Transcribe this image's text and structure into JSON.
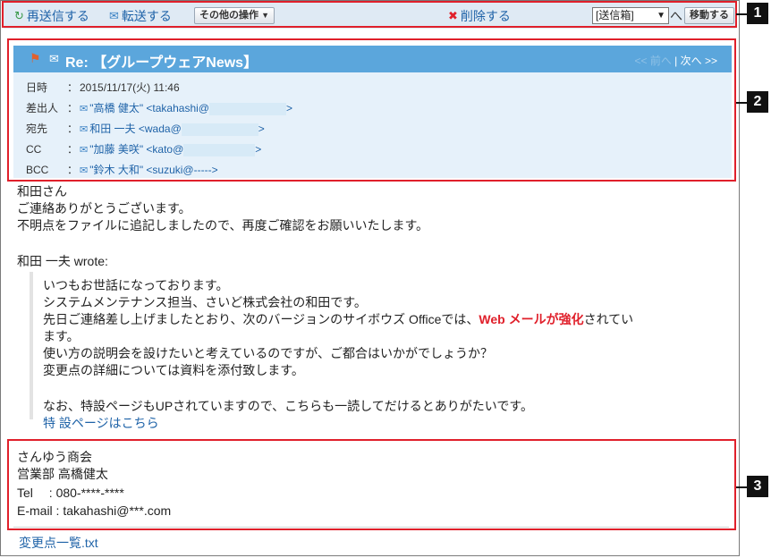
{
  "toolbar": {
    "resend": "再送信する",
    "forward": "転送する",
    "other_ops": "その他の操作",
    "delete": "削除する",
    "folder_value": "[送信箱]",
    "to_suffix": "へ",
    "move": "移動する"
  },
  "header": {
    "subject": "Re: 【グループウェアNews】",
    "prev": "<< 前へ",
    "sep": "|",
    "next": "次へ >>",
    "rows": [
      {
        "label": "日時",
        "colon": "：",
        "value": "2015/11/17(火) 11:46"
      },
      {
        "label": "差出人",
        "colon": "：",
        "value_pre": "\"高橋 健太\" <takahashi@",
        "value_post": ">"
      },
      {
        "label": "宛先",
        "colon": "：",
        "value_pre": "和田 一夫 <wada@",
        "value_post": ">"
      },
      {
        "label": "CC",
        "colon": "：",
        "value_pre": "\"加藤 美咲\" <kato@",
        "value_post": ">"
      },
      {
        "label": "BCC",
        "colon": "：",
        "value_pre": "\"鈴木 大和\" <suzuki@----->",
        "value_post": ""
      }
    ]
  },
  "body": {
    "l1": "和田さん",
    "l2": "ご連絡ありがとうございます。",
    "l3": "不明点をファイルに追記しましたので、再度ご確認をお願いいたします。",
    "l4": "和田 一夫 wrote:",
    "q1": "いつもお世話になっております。",
    "q2": "システムメンテナンス担当、さいど株式会社の和田です。",
    "q3_pre": "先日ご連絡差し上げましたとおり、次のバージョンのサイボウズ Officeでは、",
    "q3_red": "Web メールが強化",
    "q3_post": "されてい",
    "q4": "ます。",
    "q5": "使い方の説明会を設けたいと考えているのですが、ご都合はいかがでしょうか？",
    "q6": "変更点の詳細については資料を添付致します。",
    "q7": "なお、特設ページもUPされていますので、こちらも一読してだけるとありがたいです。",
    "q8": "特 設ページはこちら"
  },
  "signature": {
    "s1": "さんゆう商会",
    "s2": "営業部 高橋健太",
    "s3": "Tel　 : 080-****-****",
    "s4": "E-mail : takahashi@***.com"
  },
  "attachment": "変更点一覧.txt",
  "badges": [
    "1",
    "2",
    "3"
  ],
  "colors": {
    "accent": "#5ba6dc",
    "highlight": "#e0202b",
    "link": "#1f63a8"
  }
}
